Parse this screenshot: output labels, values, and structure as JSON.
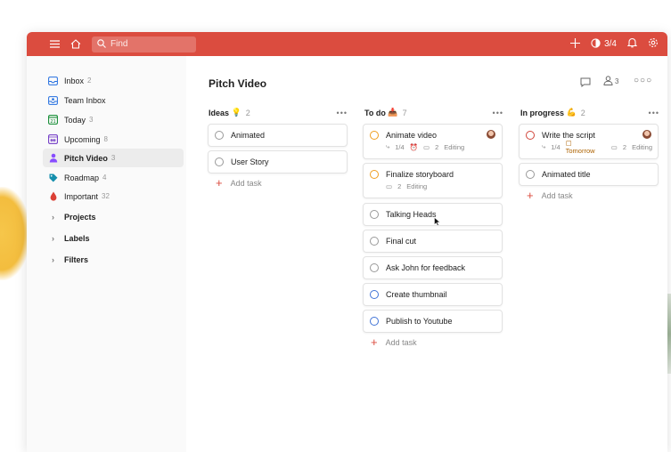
{
  "topbar": {
    "search_placeholder": "Find",
    "karma_label": "3/4",
    "icons": [
      "menu-icon",
      "home-icon",
      "search-icon",
      "add-icon",
      "karma-icon",
      "bell-icon",
      "gear-icon"
    ]
  },
  "sidebar": {
    "items": [
      {
        "label": "Inbox",
        "count": "2",
        "icon": "inbox-icon"
      },
      {
        "label": "Team Inbox",
        "count": "",
        "icon": "team-inbox-icon"
      },
      {
        "label": "Today",
        "count": "3",
        "icon": "calendar-today-icon"
      },
      {
        "label": "Upcoming",
        "count": "8",
        "icon": "calendar-grid-icon"
      },
      {
        "label": "Pitch Video",
        "count": "3",
        "icon": "person-icon"
      },
      {
        "label": "Roadmap",
        "count": "4",
        "icon": "tag-icon"
      },
      {
        "label": "Important",
        "count": "32",
        "icon": "drop-icon"
      }
    ],
    "sections": [
      "Projects",
      "Labels",
      "Filters"
    ]
  },
  "main": {
    "title": "Pitch Video",
    "collaborators_count": "3",
    "columns": [
      {
        "name": "Ideas",
        "emoji": "💡",
        "count": "2",
        "tasks": [
          {
            "title": "Animated"
          },
          {
            "title": "User Story"
          }
        ],
        "add_label": "Add task"
      },
      {
        "name": "To do",
        "emoji": "📥",
        "count": "7",
        "tasks": [
          {
            "title": "Animate video",
            "subtasks": "1/4",
            "comments": "2",
            "label": "Editing"
          },
          {
            "title": "Finalize storyboard",
            "comments": "2",
            "label": "Editing"
          },
          {
            "title": "Talking Heads"
          },
          {
            "title": "Final cut"
          },
          {
            "title": "Ask John for feedback"
          },
          {
            "title": "Create thumbnail"
          },
          {
            "title": "Publish to Youtube"
          }
        ],
        "add_label": "Add task"
      },
      {
        "name": "In progress",
        "emoji": "💪",
        "count": "2",
        "tasks": [
          {
            "title": "Write the script",
            "subtasks": "1/4",
            "due": "Tomorrow",
            "comments": "2",
            "label": "Editing"
          },
          {
            "title": "Animated title"
          }
        ],
        "add_label": "Add task"
      }
    ]
  },
  "colors": {
    "brand": "#db4c3f",
    "orange": "#f09d1e",
    "blue": "#4073d6",
    "red": "#d1453b"
  }
}
